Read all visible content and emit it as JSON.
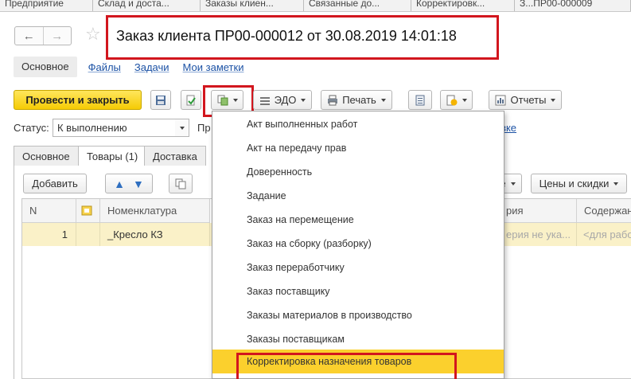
{
  "window_tabs": [
    "Предприятие",
    "Склад и доста...",
    "Заказы клиен...",
    "Связанные до...",
    "Корректировк...",
    "З...ПР00-000009"
  ],
  "title": "Заказ клиента ПР00-000012 от 30.08.2019 14:01:18",
  "nav_links": [
    "Основное",
    "Файлы",
    "Задачи",
    "Мои заметки"
  ],
  "toolbar": {
    "post_close": "Провести и закрыть",
    "edo": "ЭДО",
    "print": "Печать",
    "reports": "Отчеты"
  },
  "status": {
    "label": "Статус:",
    "value": "К выполнению",
    "next_label": "Пр",
    "right_link": "зке"
  },
  "form_tabs": [
    "Основное",
    "Товары (1)",
    "Доставка"
  ],
  "goods_toolbar": {
    "add": "Добавить",
    "prices": "Цены и скидки",
    "partial": "е"
  },
  "grid": {
    "headers": [
      "N",
      "",
      "Номенклатура",
      "рия",
      "Содержан"
    ],
    "rows": [
      {
        "n": "1",
        "item": "_Кресло КЗ",
        "char": "ерия не ука...",
        "content": "<для работ>"
      }
    ]
  },
  "menu": {
    "items": [
      "Акт выполненных работ",
      "Акт на передачу прав",
      "Доверенность",
      "Задание",
      "Заказ на перемещение",
      "Заказ на сборку (разборку)",
      "Заказ переработчику",
      "Заказ поставщику",
      "Заказы материалов в производство",
      "Заказы поставщикам",
      "Корректировка назначения товаров"
    ],
    "selected_index": 10
  },
  "colors": {
    "highlight_red": "#d2161e",
    "menu_selection": "#fbd02d",
    "row_selection": "#faf1c8",
    "post_button": "#f5cb05",
    "link": "#1c52a5"
  }
}
